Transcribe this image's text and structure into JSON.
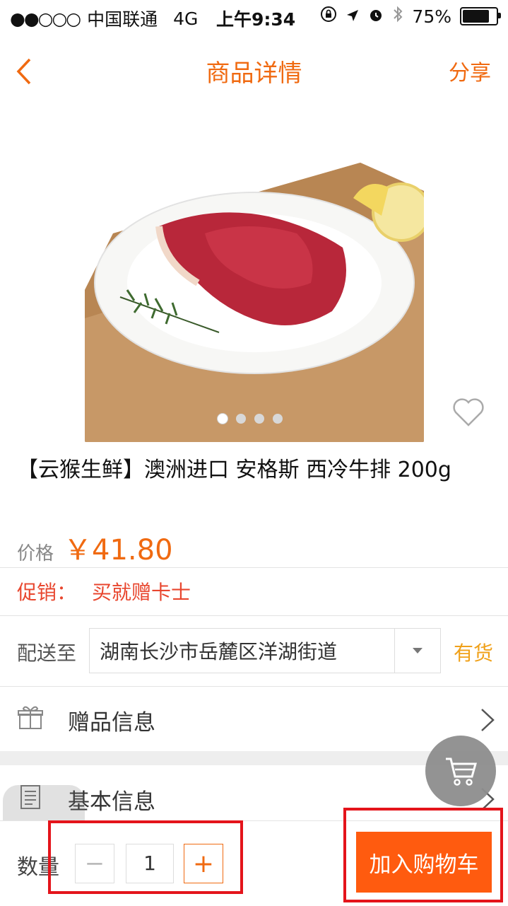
{
  "status_bar": {
    "signal": "●●○○○",
    "carrier": "中国联通",
    "network": "4G",
    "time": "上午9:34",
    "battery": "75%",
    "battery_level": 0.75
  },
  "nav": {
    "title": "商品详情",
    "share": "分享",
    "back_icon": "chevron-left-icon"
  },
  "carousel": {
    "pages": 4,
    "active": 1
  },
  "product": {
    "title": "【云猴生鲜】澳洲进口 安格斯 西冷牛排 200g",
    "price_label": "价格",
    "price": "￥41.80"
  },
  "promo": {
    "label": "促销：",
    "text": "买就赠卡士"
  },
  "shipping": {
    "label": "配送至",
    "address": "湖南长沙市岳麓区洋湖街道",
    "stock": "有货"
  },
  "rows": {
    "gift": "赠品信息",
    "basic": "基本信息"
  },
  "bottom": {
    "qty_label": "数量",
    "minus": "−",
    "qty": "1",
    "plus": "+",
    "add_to_cart": "加入购物车"
  },
  "colors": {
    "accent": "#f06a11",
    "promo": "#e8462e",
    "stock": "#f0a11a",
    "cta": "#ff5b0f",
    "highlight": "#e4141b"
  }
}
